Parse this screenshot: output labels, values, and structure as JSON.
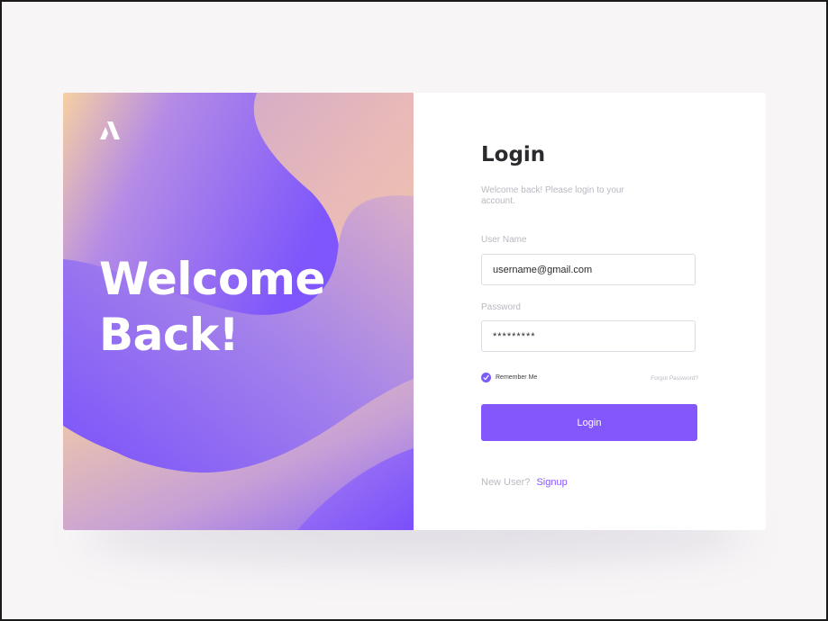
{
  "hero": {
    "line1": "Welcome",
    "line2": "Back!"
  },
  "login": {
    "title": "Login",
    "subtitle": "Welcome back! Please login to your account.",
    "username_label": "User Name",
    "username_value": "username@gmail.com",
    "password_label": "Password",
    "password_value": "*********",
    "remember_label": "Remember Me",
    "remember_checked": true,
    "forgot_label": "Forgot Password?",
    "button_label": "Login",
    "new_user_text": "New User?",
    "signup_label": "Signup"
  },
  "icons": {
    "logo": "brand-logo-icon",
    "check": "check-icon"
  },
  "colors": {
    "accent": "#8357fb",
    "gradient_purple": "#7b55fb",
    "gradient_peach": "#f8d3a1",
    "page_background": "#f7f5f6"
  }
}
